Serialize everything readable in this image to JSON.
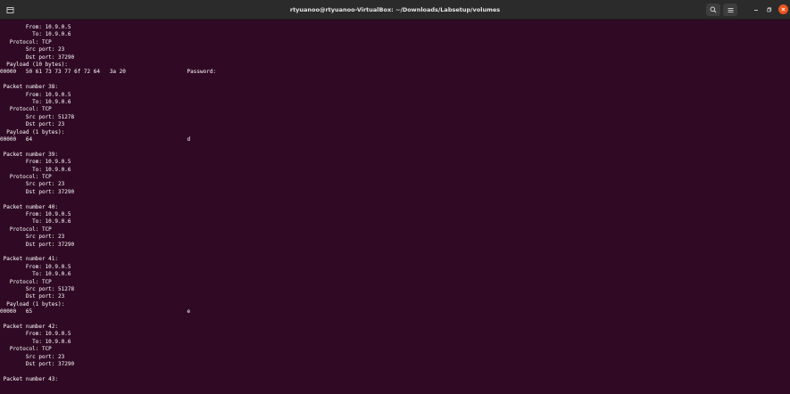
{
  "window": {
    "title": "rtyuanoo@rtyuanoo-VirtualBox: ~/Downloads/Labsetup/volumes",
    "icons": {
      "new_tab": "new-tab-icon",
      "search": "search-icon",
      "menu": "hamburger-menu-icon",
      "minimize": "minimize-icon",
      "maximize": "maximize-icon",
      "close": "close-icon"
    },
    "colors": {
      "background": "#300a24",
      "titlebar": "#2b2b2b",
      "close": "#e95420",
      "text": "#ffffff"
    }
  },
  "terminal": {
    "lines": [
      "        From: 10.9.0.5",
      "          To: 10.9.0.6",
      "   Protocol: TCP",
      "        Src port: 23",
      "        Dst port: 37290",
      "  Payload (10 bytes):",
      "00000   50 61 73 73 77 6f 72 64   3a 20                   Password: ",
      "",
      " Packet number 38:",
      "        From: 10.9.0.5",
      "          To: 10.9.0.6",
      "   Protocol: TCP",
      "        Src port: 51278",
      "        Dst port: 23",
      "  Payload (1 bytes):",
      "00000   64                                                d",
      "",
      " Packet number 39:",
      "        From: 10.9.0.5",
      "          To: 10.9.0.6",
      "   Protocol: TCP",
      "        Src port: 23",
      "        Dst port: 37290",
      "",
      " Packet number 40:",
      "        From: 10.9.0.5",
      "          To: 10.9.0.6",
      "   Protocol: TCP",
      "        Src port: 23",
      "        Dst port: 37290",
      "",
      " Packet number 41:",
      "        From: 10.9.0.5",
      "          To: 10.9.0.6",
      "   Protocol: TCP",
      "        Src port: 51278",
      "        Dst port: 23",
      "  Payload (1 bytes):",
      "00000   65                                                e",
      "",
      " Packet number 42:",
      "        From: 10.9.0.5",
      "          To: 10.9.0.6",
      "   Protocol: TCP",
      "        Src port: 23",
      "        Dst port: 37290",
      "",
      " Packet number 43:"
    ]
  }
}
